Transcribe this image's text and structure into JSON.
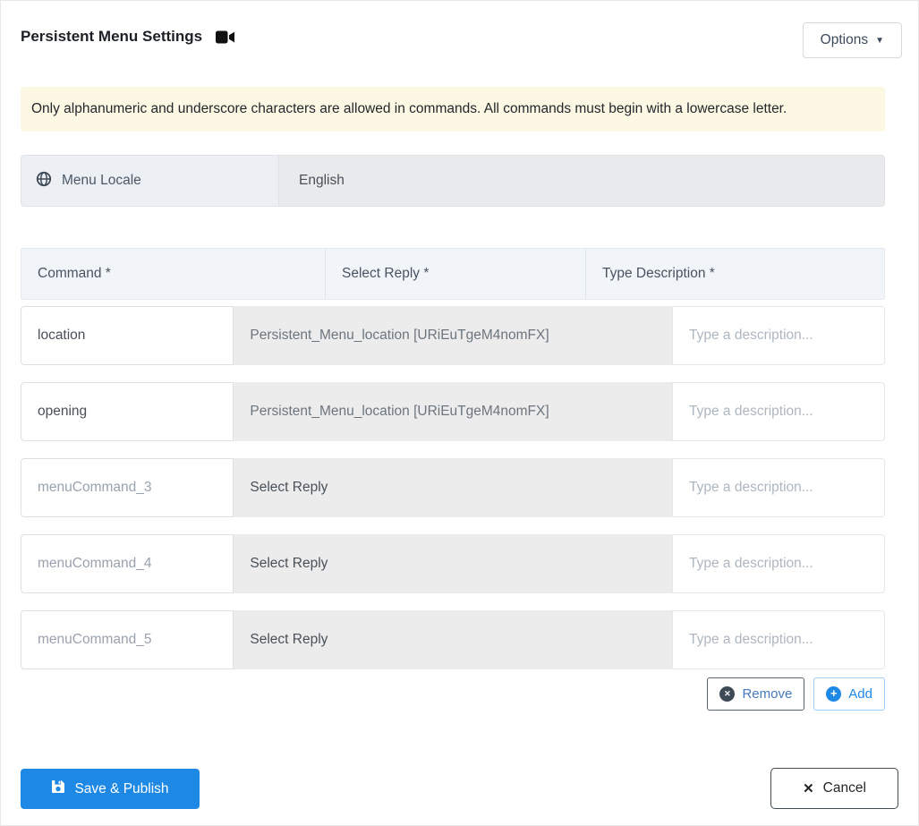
{
  "header": {
    "title": "Persistent Menu Settings",
    "options_button": "Options"
  },
  "alert": {
    "text": "Only alphanumeric and underscore characters are allowed in commands. All commands must begin with a lowercase letter."
  },
  "locale": {
    "label": "Menu Locale",
    "value": "English"
  },
  "table": {
    "headers": {
      "command": "Command *",
      "reply": "Select Reply *",
      "description": "Type Description *"
    },
    "rows": [
      {
        "command_value": "location",
        "reply": "Persistent_Menu_location [URiEuTgeM4nomFX]",
        "description_placeholder": "Type a description..."
      },
      {
        "command_value": "opening",
        "reply": "Persistent_Menu_location [URiEuTgeM4nomFX]",
        "description_placeholder": "Type a description..."
      },
      {
        "command_placeholder": "menuCommand_3",
        "reply": "Select Reply",
        "description_placeholder": "Type a description..."
      },
      {
        "command_placeholder": "menuCommand_4",
        "reply": "Select Reply",
        "description_placeholder": "Type a description..."
      },
      {
        "command_placeholder": "menuCommand_5",
        "reply": "Select Reply",
        "description_placeholder": "Type a description..."
      }
    ]
  },
  "actions": {
    "remove_label": "Remove",
    "add_label": "Add"
  },
  "footer": {
    "save_label": "Save & Publish",
    "cancel_label": "Cancel"
  },
  "icons": {
    "title": "video-camera",
    "locale": "globe",
    "options": "caret-down",
    "remove": "x-circle",
    "add": "plus-circle",
    "save": "floppy-disk",
    "cancel": "x-mark"
  },
  "colors": {
    "primary_blue": "#1e88e5",
    "alert_bg": "#fcf8e3",
    "table_header_bg": "#f1f5f9",
    "reply_bg": "#ececec",
    "remove_icon_bg": "#3e4a56",
    "remove_text": "#4679bd",
    "add_border": "#9ecdf9"
  }
}
